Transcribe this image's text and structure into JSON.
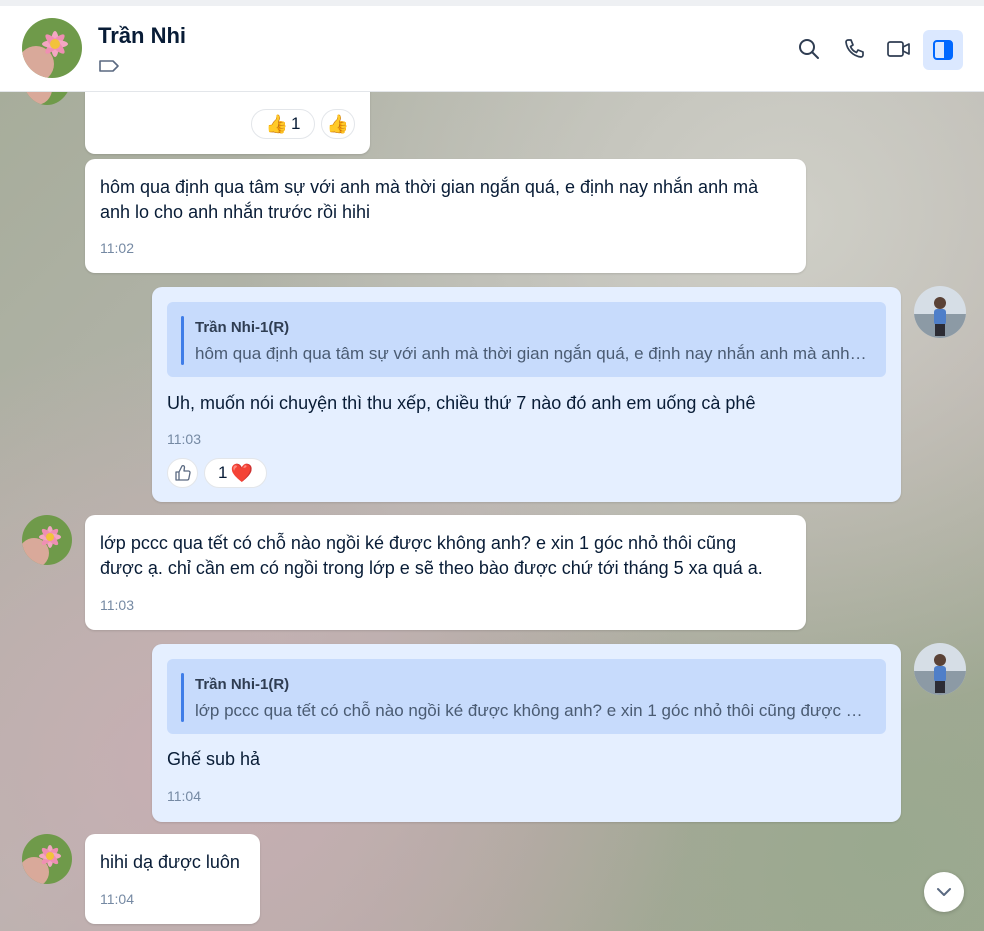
{
  "header": {
    "name": "Trần Nhi",
    "icons": [
      "search-icon",
      "phone-icon",
      "video-call-icon",
      "sidebar-toggle-icon"
    ],
    "tag_icon": "tag-icon"
  },
  "messages": [
    {
      "id": "m0",
      "side": "received",
      "reactions": [
        {
          "emoji": "👍",
          "count": "1"
        },
        {
          "emoji": "👍",
          "count": ""
        }
      ]
    },
    {
      "id": "m1",
      "side": "received",
      "text_line1": "hôm qua định qua tâm sự với anh mà thời gian ngắn quá, e định nay nhắn anh mà",
      "text_line2": "anh lo cho anh nhắn trước rồi hihi",
      "time": "11:02"
    },
    {
      "id": "m2",
      "side": "sent",
      "quote_name": "Trần Nhi-1(R)",
      "quote_text": "hôm qua định qua tâm sự với anh mà thời gian ngắn quá, e định nay nhắn anh mà anh…",
      "text": "Uh, muốn nói chuyện thì thu xếp, chiều thứ 7 nào đó anh em uống cà phê",
      "time": "11:03",
      "reaction_count": "1",
      "reaction_emoji": "❤️"
    },
    {
      "id": "m3",
      "side": "received",
      "text_line1": "lớp pccc qua tết có chỗ nào ngồi ké được không anh? e xin 1 góc nhỏ thôi cũng",
      "text_line2": "được ạ. chỉ cần em có ngồi trong lớp e sẽ theo bào được chứ tới tháng 5 xa quá a.",
      "time": "11:03"
    },
    {
      "id": "m4",
      "side": "sent",
      "quote_name": "Trần Nhi-1(R)",
      "quote_text": "lớp pccc qua tết có chỗ nào ngồi ké được không anh? e xin 1 góc nhỏ thôi cũng được …",
      "text": "Ghế sub hả",
      "time": "11:04"
    },
    {
      "id": "m5",
      "side": "received",
      "text": "hihi dạ được luôn",
      "time": "11:04"
    }
  ]
}
